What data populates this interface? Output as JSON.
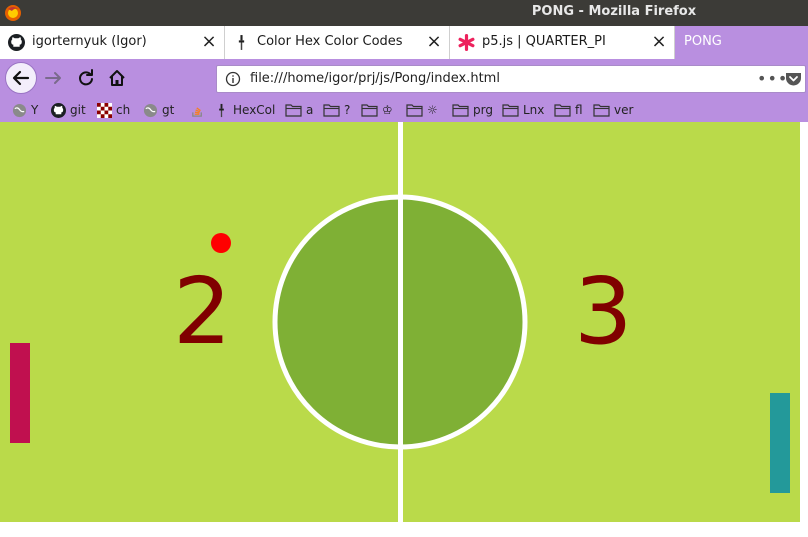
{
  "window": {
    "title": "PONG - Mozilla Firefox"
  },
  "tabs": [
    {
      "label": "igorternyuk (Igor)",
      "icon": "github-icon"
    },
    {
      "label": "Color Hex Color Codes",
      "icon": "pipette-icon"
    },
    {
      "label": "p5.js | QUARTER_PI",
      "icon": "p5-asterisk-icon"
    },
    {
      "label": "PONG",
      "active": true
    }
  ],
  "urlbar": {
    "url": "file:///home/igor/prj/js/Pong/index.html"
  },
  "bookmarks": [
    {
      "label": "Y",
      "icon": "globe-icon"
    },
    {
      "label": "git",
      "icon": "github-icon"
    },
    {
      "label": "ch",
      "icon": "chess-icon"
    },
    {
      "label": "gt",
      "icon": "globe-icon"
    },
    {
      "label": "",
      "icon": "stackoverflow-icon"
    },
    {
      "label": "HexCol",
      "icon": "pipette-icon"
    },
    {
      "label": "a",
      "icon": "folder-icon"
    },
    {
      "label": "?",
      "icon": "folder-icon"
    },
    {
      "label": "♔",
      "icon": "folder-icon"
    },
    {
      "label": "☼",
      "icon": "folder-icon"
    },
    {
      "label": "prg",
      "icon": "folder-icon"
    },
    {
      "label": "Lnx",
      "icon": "folder-icon"
    },
    {
      "label": "fl",
      "icon": "folder-icon"
    },
    {
      "label": "ver",
      "icon": "folder-icon"
    }
  ],
  "game": {
    "left_score": "2",
    "right_score": "3",
    "colors": {
      "field": "#bada4a",
      "center_circle": "#7fb035",
      "lines": "#ffffff",
      "left_paddle": "#c0104f",
      "right_paddle": "#23999a",
      "ball": "#ff0000",
      "score": "#800000"
    }
  },
  "colors": {
    "chrome_accent": "#b98fe0",
    "titlebar": "#3c3b37"
  }
}
